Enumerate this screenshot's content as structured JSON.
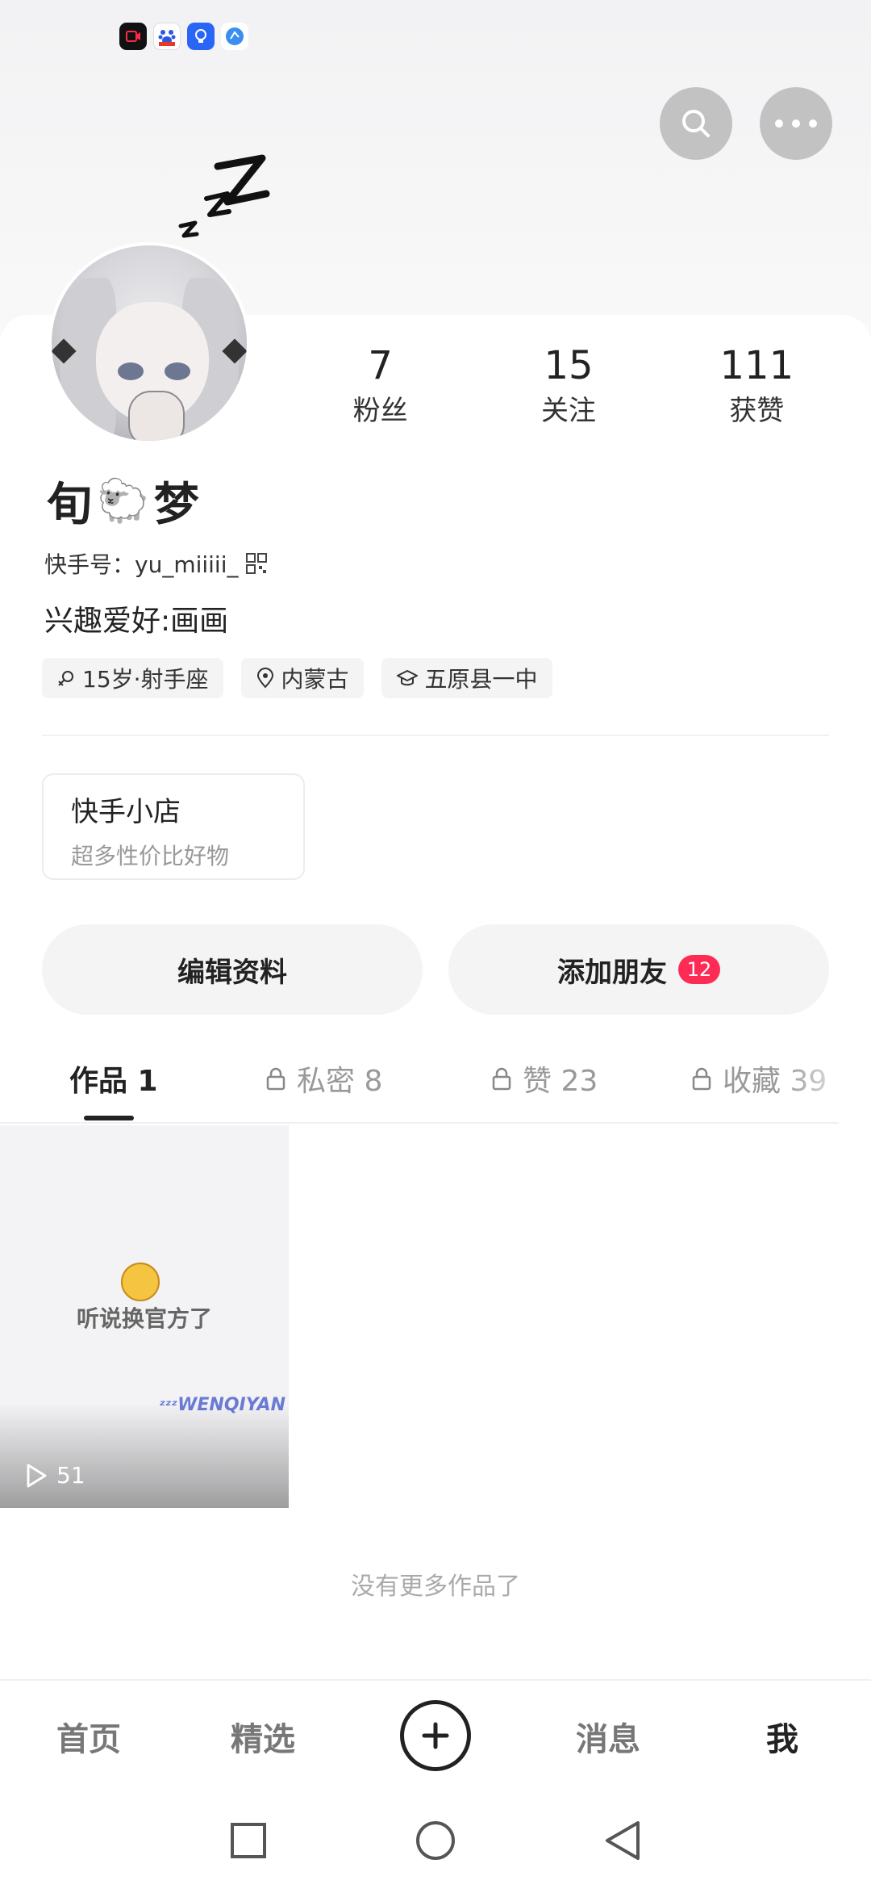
{
  "status_bar": {
    "icons": [
      "screen-record-icon",
      "baidu-icon",
      "lightbulb-icon",
      "browser-icon"
    ]
  },
  "profile": {
    "name_part1": "旬",
    "name_emoji": "🐑",
    "name_part2": "梦",
    "kuaishou_id": "快手号：yu_miiiii_",
    "bio": "兴趣爱好:画画",
    "tags": [
      "15岁·射手座",
      "内蒙古",
      "五原县一中"
    ]
  },
  "stats": [
    {
      "value": "7",
      "label": "粉丝"
    },
    {
      "value": "15",
      "label": "关注"
    },
    {
      "value": "111",
      "label": "获赞"
    }
  ],
  "shop": {
    "title": "快手小店",
    "subtitle": "超多性价比好物"
  },
  "actions": {
    "edit": "编辑资料",
    "add_friend": "添加朋友",
    "add_friend_badge": "12"
  },
  "tabs": [
    {
      "label": "作品 1",
      "locked": false
    },
    {
      "label": "私密 8",
      "locked": true
    },
    {
      "label": "赞 23",
      "locked": true
    },
    {
      "label": "收藏 39",
      "locked": true
    }
  ],
  "video": {
    "caption": "听说换官方了",
    "watermark": "WENQIYAN",
    "plays": "51"
  },
  "no_more": "没有更多作品了",
  "bottom_nav": {
    "home": "首页",
    "featured": "精选",
    "messages": "消息",
    "me": "我"
  },
  "colors": {
    "accent": "#fe2c55",
    "tab_active": "#222222",
    "tag_bg": "#f4f4f5"
  }
}
